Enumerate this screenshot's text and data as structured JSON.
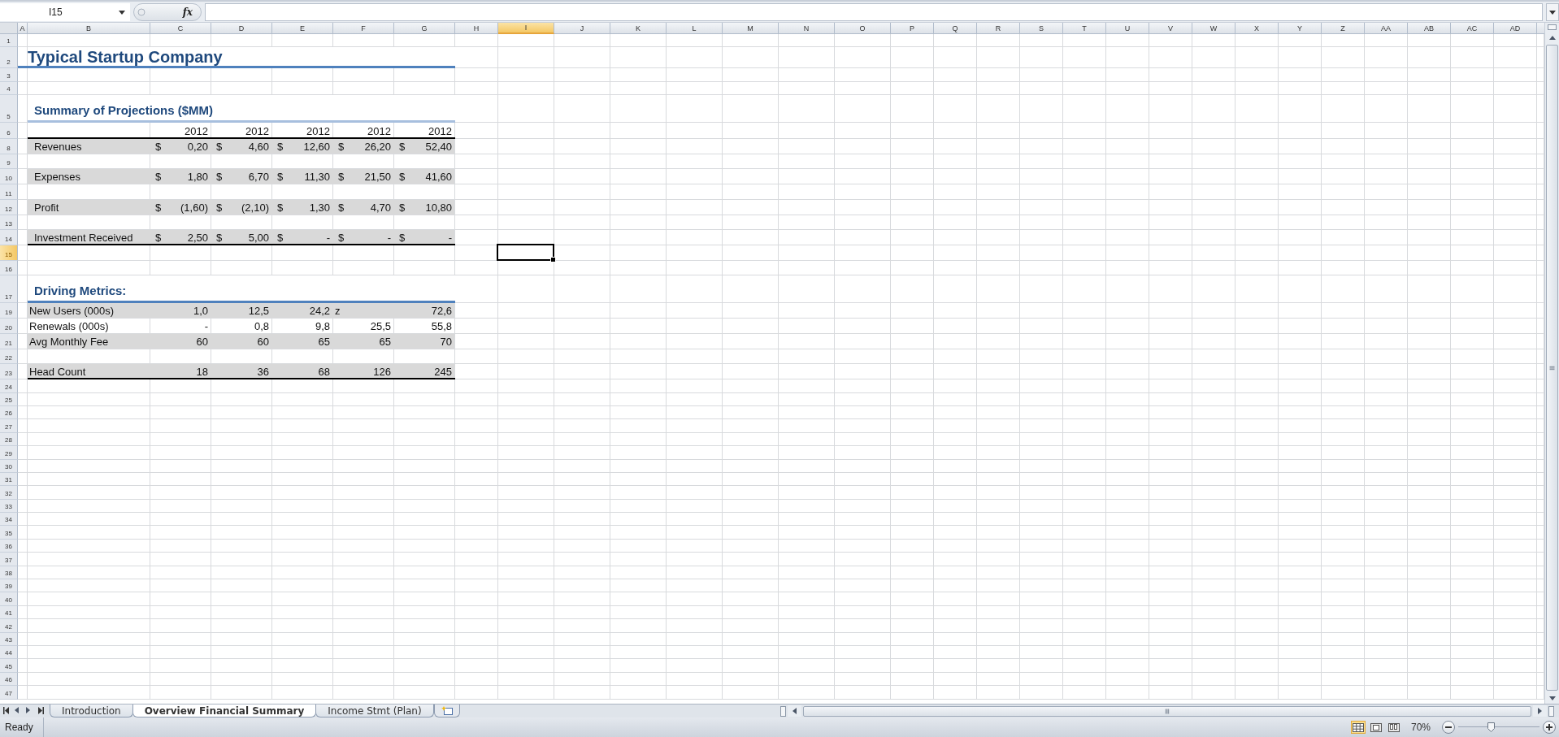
{
  "formula_bar": {
    "name_box": "I15",
    "fx_label": "fx"
  },
  "columns": [
    {
      "label": "A",
      "selected": false
    },
    {
      "label": "B",
      "selected": false
    },
    {
      "label": "C",
      "selected": false
    },
    {
      "label": "D",
      "selected": false
    },
    {
      "label": "E",
      "selected": false
    },
    {
      "label": "F",
      "selected": false
    },
    {
      "label": "G",
      "selected": false
    },
    {
      "label": "H",
      "selected": false
    },
    {
      "label": "I",
      "selected": true
    },
    {
      "label": "J",
      "selected": false
    },
    {
      "label": "K",
      "selected": false
    },
    {
      "label": "L",
      "selected": false
    },
    {
      "label": "M",
      "selected": false
    },
    {
      "label": "N",
      "selected": false
    },
    {
      "label": "O",
      "selected": false
    },
    {
      "label": "P",
      "selected": false
    },
    {
      "label": "Q",
      "selected": false
    },
    {
      "label": "R",
      "selected": false
    },
    {
      "label": "S",
      "selected": false
    },
    {
      "label": "T",
      "selected": false
    },
    {
      "label": "U",
      "selected": false
    },
    {
      "label": "V",
      "selected": false
    },
    {
      "label": "W",
      "selected": false
    },
    {
      "label": "X",
      "selected": false
    },
    {
      "label": "Y",
      "selected": false
    },
    {
      "label": "Z",
      "selected": false
    },
    {
      "label": "AA",
      "selected": false
    },
    {
      "label": "AB",
      "selected": false
    },
    {
      "label": "AC",
      "selected": false
    },
    {
      "label": "AD",
      "selected": false
    }
  ],
  "rows": [
    {
      "number": "1",
      "selected": false,
      "kind": "blank"
    },
    {
      "number": "2",
      "selected": false,
      "kind": "title",
      "text": "Typical Startup Company",
      "rule": {
        "kind": "accent"
      }
    },
    {
      "number": "3",
      "selected": false,
      "kind": "blank"
    },
    {
      "number": "4",
      "selected": false,
      "kind": "blank"
    },
    {
      "number": "5",
      "selected": false,
      "kind": "section",
      "text": "Summary of Projections ($MM)",
      "rule": {
        "kind": "accent-light"
      }
    },
    {
      "number": "6",
      "selected": false,
      "kind": "years",
      "values": [
        "2012",
        "2012",
        "2012",
        "2012",
        "2012"
      ],
      "rule": {
        "kind": "total"
      }
    },
    {
      "number": "8",
      "selected": false,
      "kind": "money",
      "shaded": true,
      "label": "Revenues",
      "cells": [
        {
          "currency": "$",
          "value": "0,20"
        },
        {
          "currency": "$",
          "value": "4,60"
        },
        {
          "currency": "$",
          "value": "12,60"
        },
        {
          "currency": "$",
          "value": "26,20"
        },
        {
          "currency": "$",
          "value": "52,40"
        }
      ]
    },
    {
      "number": "9",
      "selected": false,
      "kind": "spacer"
    },
    {
      "number": "10",
      "selected": false,
      "kind": "money",
      "shaded": true,
      "label": "Expenses",
      "cells": [
        {
          "currency": "$",
          "value": "1,80"
        },
        {
          "currency": "$",
          "value": "6,70"
        },
        {
          "currency": "$",
          "value": "11,30"
        },
        {
          "currency": "$",
          "value": "21,50"
        },
        {
          "currency": "$",
          "value": "41,60"
        }
      ]
    },
    {
      "number": "11",
      "selected": false,
      "kind": "spacer"
    },
    {
      "number": "12",
      "selected": false,
      "kind": "money",
      "shaded": true,
      "label": "Profit",
      "cells": [
        {
          "currency": "$",
          "value": "(1,60)"
        },
        {
          "currency": "$",
          "value": "(2,10)"
        },
        {
          "currency": "$",
          "value": "1,30"
        },
        {
          "currency": "$",
          "value": "4,70"
        },
        {
          "currency": "$",
          "value": "10,80"
        }
      ]
    },
    {
      "number": "13",
      "selected": false,
      "kind": "spacer"
    },
    {
      "number": "14",
      "selected": false,
      "kind": "money",
      "shaded": true,
      "label": "Investment Received",
      "rule": {
        "kind": "total"
      },
      "cells": [
        {
          "currency": "$",
          "value": "2,50"
        },
        {
          "currency": "$",
          "value": "5,00"
        },
        {
          "currency": "$",
          "value": "-"
        },
        {
          "currency": "$",
          "value": "-"
        },
        {
          "currency": "$",
          "value": "-"
        }
      ]
    },
    {
      "number": "15",
      "selected": true,
      "kind": "spacer"
    },
    {
      "number": "16",
      "selected": false,
      "kind": "spacer"
    },
    {
      "number": "17",
      "selected": false,
      "kind": "section",
      "text": "Driving Metrics:",
      "rule": {
        "kind": "accent"
      }
    },
    {
      "number": "19",
      "selected": false,
      "kind": "metric",
      "shaded": true,
      "label": "New Users (000s)",
      "cells": [
        {
          "kind": "number",
          "value": "1,0"
        },
        {
          "kind": "number",
          "value": "12,5"
        },
        {
          "kind": "number",
          "value": "24,2"
        },
        {
          "kind": "text",
          "value": "z"
        },
        {
          "kind": "number",
          "value": "72,6"
        }
      ]
    },
    {
      "number": "20",
      "selected": false,
      "kind": "metric",
      "label": "Renewals (000s)",
      "cells": [
        {
          "kind": "number",
          "value": "-"
        },
        {
          "kind": "number",
          "value": "0,8"
        },
        {
          "kind": "number",
          "value": "9,8"
        },
        {
          "kind": "number",
          "value": "25,5"
        },
        {
          "kind": "number",
          "value": "55,8"
        }
      ]
    },
    {
      "number": "21",
      "selected": false,
      "kind": "metric",
      "shaded": true,
      "label": "Avg Monthly Fee",
      "cells": [
        {
          "kind": "number",
          "value": "60"
        },
        {
          "kind": "number",
          "value": "60"
        },
        {
          "kind": "number",
          "value": "65"
        },
        {
          "kind": "number",
          "value": "65"
        },
        {
          "kind": "number",
          "value": "70"
        }
      ]
    },
    {
      "number": "22",
      "selected": false,
      "kind": "spacer"
    },
    {
      "number": "23",
      "selected": false,
      "kind": "metric",
      "shaded": true,
      "label": "Head Count",
      "rule": {
        "kind": "total"
      },
      "cells": [
        {
          "kind": "number",
          "value": "18"
        },
        {
          "kind": "number",
          "value": "36"
        },
        {
          "kind": "number",
          "value": "68"
        },
        {
          "kind": "number",
          "value": "126"
        },
        {
          "kind": "number",
          "value": "245"
        }
      ]
    },
    {
      "number": "24",
      "selected": false,
      "kind": "blank"
    },
    {
      "number": "25",
      "selected": false,
      "kind": "blank"
    },
    {
      "number": "26",
      "selected": false,
      "kind": "blank"
    },
    {
      "number": "27",
      "selected": false,
      "kind": "blank"
    },
    {
      "number": "28",
      "selected": false,
      "kind": "blank"
    },
    {
      "number": "29",
      "selected": false,
      "kind": "blank"
    },
    {
      "number": "30",
      "selected": false,
      "kind": "blank"
    },
    {
      "number": "31",
      "selected": false,
      "kind": "blank"
    },
    {
      "number": "32",
      "selected": false,
      "kind": "blank"
    },
    {
      "number": "33",
      "selected": false,
      "kind": "blank"
    },
    {
      "number": "34",
      "selected": false,
      "kind": "blank"
    },
    {
      "number": "35",
      "selected": false,
      "kind": "blank"
    },
    {
      "number": "36",
      "selected": false,
      "kind": "blank"
    },
    {
      "number": "37",
      "selected": false,
      "kind": "blank"
    },
    {
      "number": "38",
      "selected": false,
      "kind": "blank"
    },
    {
      "number": "39",
      "selected": false,
      "kind": "blank"
    },
    {
      "number": "40",
      "selected": false,
      "kind": "blank"
    },
    {
      "number": "41",
      "selected": false,
      "kind": "blank"
    },
    {
      "number": "42",
      "selected": false,
      "kind": "blank"
    },
    {
      "number": "43",
      "selected": false,
      "kind": "blank"
    },
    {
      "number": "44",
      "selected": false,
      "kind": "blank"
    },
    {
      "number": "45",
      "selected": false,
      "kind": "blank"
    },
    {
      "number": "46",
      "selected": false,
      "kind": "blank"
    },
    {
      "number": "47",
      "selected": false,
      "kind": "blank"
    }
  ],
  "sheet_tabs": [
    {
      "label": "Introduction",
      "selected": false
    },
    {
      "label": "Overview Financial Summary",
      "selected": true
    },
    {
      "label": "Income Stmt (Plan)",
      "selected": false
    }
  ],
  "status_bar": {
    "status": "Ready",
    "views": [
      {
        "kind": "normal",
        "selected": true
      },
      {
        "kind": "page-layout",
        "selected": false
      },
      {
        "kind": "page-break",
        "selected": false
      }
    ],
    "zoom": {
      "reading": "70%",
      "level": 0.4
    }
  }
}
